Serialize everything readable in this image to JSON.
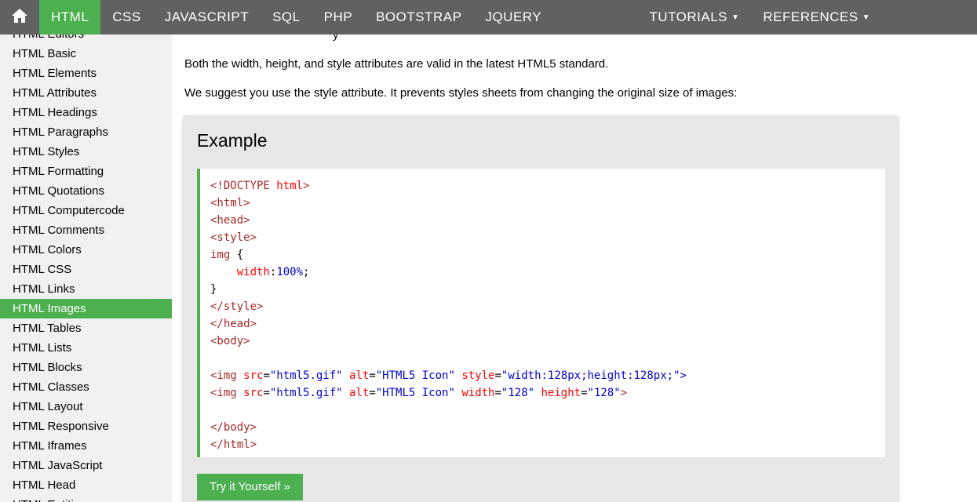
{
  "topnav": {
    "home_icon": "home-icon",
    "items": [
      {
        "label": "HTML",
        "active": true
      },
      {
        "label": "CSS"
      },
      {
        "label": "JAVASCRIPT"
      },
      {
        "label": "SQL"
      },
      {
        "label": "PHP"
      },
      {
        "label": "BOOTSTRAP"
      },
      {
        "label": "JQUERY"
      }
    ],
    "right_items": [
      {
        "label": "TUTORIALS",
        "caret": "▼"
      },
      {
        "label": "REFERENCES",
        "caret": "▼"
      }
    ]
  },
  "sidebar": {
    "items": [
      "HTML Editors",
      "HTML Basic",
      "HTML Elements",
      "HTML Attributes",
      "HTML Headings",
      "HTML Paragraphs",
      "HTML Styles",
      "HTML Formatting",
      "HTML Quotations",
      "HTML Computercode",
      "HTML Comments",
      "HTML Colors",
      "HTML CSS",
      "HTML Links",
      "HTML Images",
      "HTML Tables",
      "HTML Lists",
      "HTML Blocks",
      "HTML Classes",
      "HTML Layout",
      "HTML Responsive",
      "HTML Iframes",
      "HTML JavaScript",
      "HTML Head",
      "HTML Entities"
    ],
    "active_index": 14
  },
  "main": {
    "fragment": "y",
    "p1": "Both the width, height, and style attributes are valid in the latest HTML5 standard.",
    "p2": "We suggest you use the style attribute. It prevents styles sheets from changing the original size of images:",
    "example_title": "Example",
    "try_button": "Try it Yourself »"
  },
  "code": {
    "doctype_open": "<!DOCTYPE",
    "doctype_attr": " html",
    "doctype_close": ">",
    "html_open": "<html>",
    "head_open": "<head>",
    "style_open": "<style>",
    "selector": "img",
    "brace_open": " {",
    "indent": "    ",
    "prop": "width",
    "colon": ":",
    "prop_value": "100%",
    "semicolon": ";",
    "brace_close": "}",
    "style_close": "</style>",
    "head_close": "</head>",
    "body_open": "<body>",
    "img_tag": "<img",
    "attr_src": " src",
    "eq": "=",
    "val_src": "\"html5.gif\"",
    "attr_alt": " alt",
    "val_alt": "\"HTML5 Icon\"",
    "attr_style": " style",
    "val_style": "\"width:128px;height:128px;\"",
    "tag_end": ">",
    "attr_width": " width",
    "val_width": "\"128\"",
    "attr_height": " height",
    "val_height": "\"128\"",
    "body_close": "</body>",
    "html_close": "</html>"
  },
  "colors": {
    "nav_bg": "#616161",
    "accent": "#4caf50",
    "sidebar_bg": "#f1f1f1",
    "example_bg": "#e7e7e7"
  }
}
